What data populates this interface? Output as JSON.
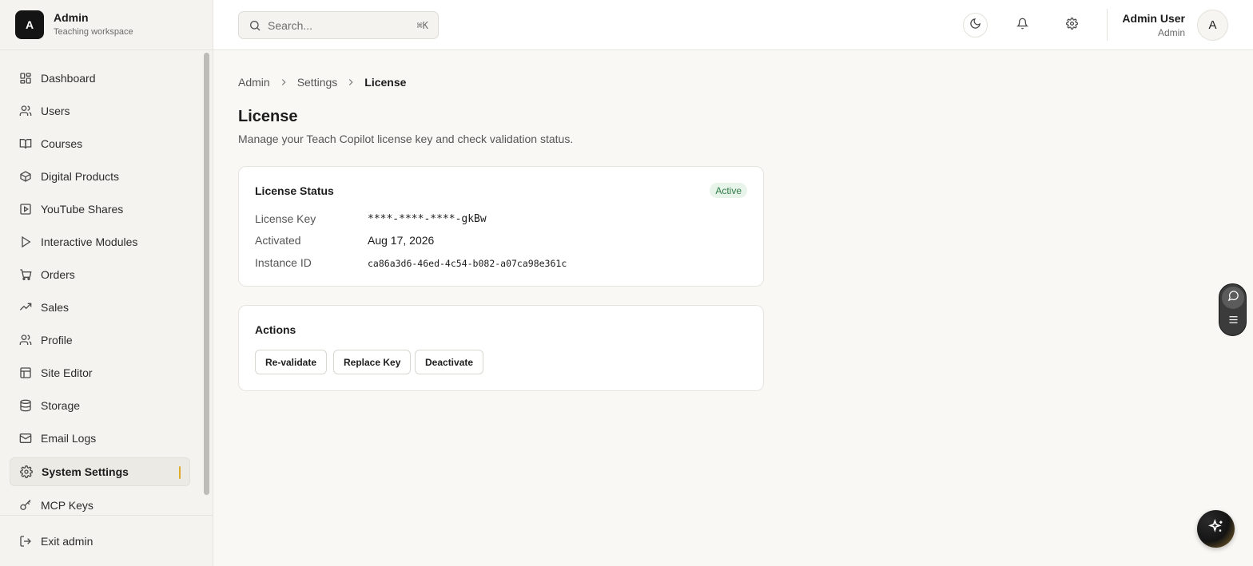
{
  "brand": {
    "logo_letter": "A",
    "name": "Admin",
    "subtitle": "Teaching workspace"
  },
  "sidebar": {
    "items": [
      {
        "label": "Dashboard",
        "icon": "dashboard-icon"
      },
      {
        "label": "Users",
        "icon": "users-icon"
      },
      {
        "label": "Courses",
        "icon": "book-icon"
      },
      {
        "label": "Digital Products",
        "icon": "package-icon"
      },
      {
        "label": "YouTube Shares",
        "icon": "video-icon"
      },
      {
        "label": "Interactive Modules",
        "icon": "play-icon"
      },
      {
        "label": "Orders",
        "icon": "cart-icon"
      },
      {
        "label": "Sales",
        "icon": "trending-up-icon"
      },
      {
        "label": "Profile",
        "icon": "users-icon"
      },
      {
        "label": "Site Editor",
        "icon": "layout-icon"
      },
      {
        "label": "Storage",
        "icon": "database-icon"
      },
      {
        "label": "Email Logs",
        "icon": "mail-icon"
      },
      {
        "label": "System Settings",
        "icon": "gear-icon",
        "active": true
      },
      {
        "label": "MCP Keys",
        "icon": "key-icon"
      }
    ],
    "exit_label": "Exit admin",
    "accent_color": "#e0a92a"
  },
  "topbar": {
    "search_placeholder": "Search...",
    "search_shortcut": "⌘K",
    "user_name": "Admin User",
    "user_role": "Admin",
    "avatar_letter": "A"
  },
  "breadcrumb": {
    "items": [
      "Admin",
      "Settings"
    ],
    "current": "License"
  },
  "page": {
    "title": "License",
    "description": "Manage your Teach Copilot license key and check validation status."
  },
  "license_card": {
    "title": "License Status",
    "status_badge": "Active",
    "status_color": "#2e7d46",
    "rows": [
      {
        "label": "License Key",
        "value": "****-****-****-gkBw"
      },
      {
        "label": "Activated",
        "value": "Aug 17, 2026"
      },
      {
        "label": "Instance ID",
        "value": "ca86a3d6-46ed-4c54-b082-a07ca98e361c"
      }
    ]
  },
  "actions_card": {
    "title": "Actions",
    "buttons": [
      "Re-validate",
      "Replace Key",
      "Deactivate"
    ]
  }
}
